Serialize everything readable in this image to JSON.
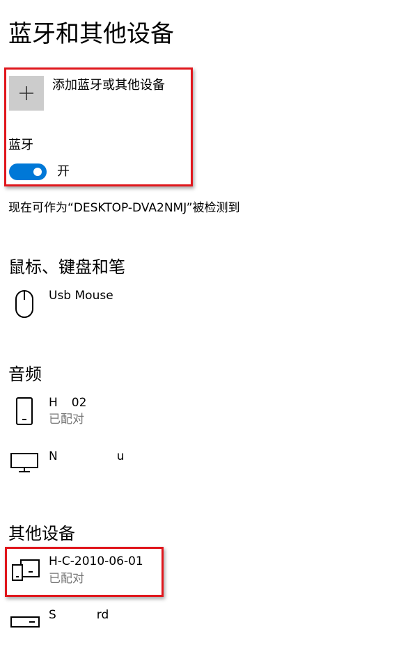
{
  "page": {
    "title": "蓝牙和其他设备"
  },
  "add_device": {
    "label": "添加蓝牙或其他设备",
    "icon": "plus-icon"
  },
  "bluetooth": {
    "label": "蓝牙",
    "state_label": "开",
    "on": true,
    "accent_color": "#0078d7",
    "discoverable_text": "现在可作为“DESKTOP-DVA2NMJ”被检测到"
  },
  "sections": {
    "mouse_keyboard_pen": {
      "title": "鼠标、键盘和笔",
      "devices": [
        {
          "name": "Usb Mouse",
          "icon": "mouse-icon"
        }
      ]
    },
    "audio": {
      "title": "音频",
      "devices": [
        {
          "name_start": "H",
          "name_end": "02",
          "status": "已配对",
          "icon": "phone-icon"
        },
        {
          "name_start": "N",
          "name_end": "u",
          "icon": "monitor-icon"
        }
      ]
    },
    "other_devices": {
      "title": "其他设备",
      "devices": [
        {
          "name": "H-C-2010-06-01",
          "status": "已配对",
          "icon": "devices-icon"
        },
        {
          "name_start": "S",
          "name_end": "rd",
          "icon": "keyboard-icon"
        }
      ]
    }
  },
  "highlight_color": "#e0161c"
}
